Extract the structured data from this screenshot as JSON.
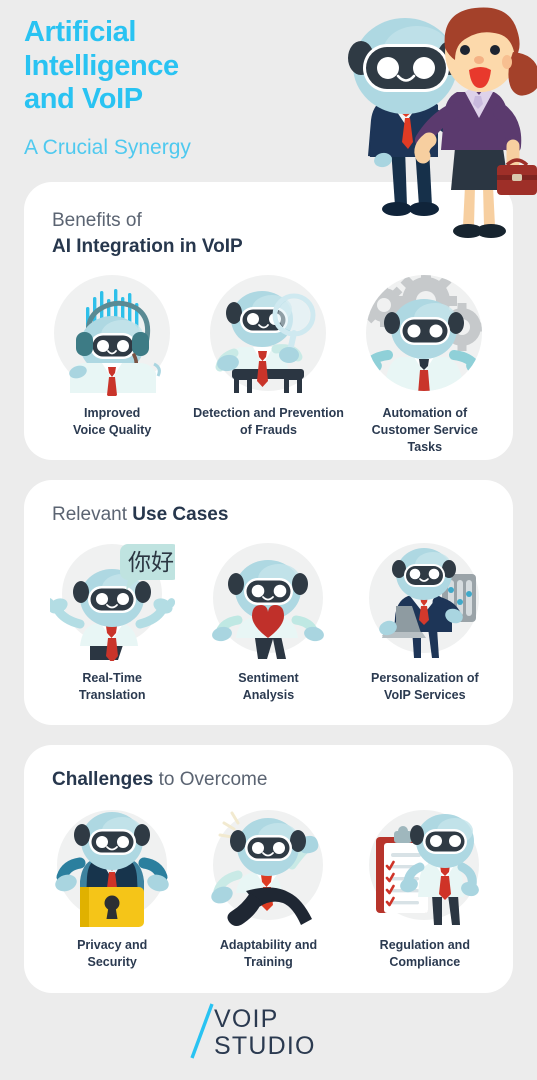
{
  "hero": {
    "title_lines": [
      "Artificial",
      "Intelligence",
      "and VoIP"
    ],
    "subtitle": "A Crucial Synergy",
    "illustration": "robot-handshake-businesswoman-illustration",
    "title_color": "#29c3f2",
    "subtitle_color": "#4fc9ef"
  },
  "theme": {
    "background": "#ececec",
    "card_background": "#ffffff",
    "accent_cyan": "#29c3f2",
    "heading_dark": "#27374d",
    "heading_light": "#5b6472",
    "caption_color": "#2b3a50",
    "robot_body": "#b8dde6",
    "robot_face": "#2f3a44",
    "tie_red": "#d93025",
    "suit_navy": "#1d3557"
  },
  "sections": [
    {
      "id": "benefits",
      "title_light": "Benefits of",
      "title_bold": "AI Integration in VoIP",
      "title_layout": "stacked",
      "items": [
        {
          "icon": "robot-headset-voice-wave-icon",
          "caption_lines": [
            "Improved",
            "Voice Quality"
          ]
        },
        {
          "icon": "robot-magnifying-glass-icon",
          "caption_lines": [
            "Detection and Prevention",
            "of Frauds"
          ]
        },
        {
          "icon": "robot-gears-automation-icon",
          "caption_lines": [
            "Automation of",
            "Customer Service",
            "Tasks"
          ]
        }
      ]
    },
    {
      "id": "use-cases",
      "title_light": "Relevant ",
      "title_bold": "Use Cases",
      "title_layout": "inline",
      "items": [
        {
          "icon": "robot-speech-bubble-chinese-icon",
          "bubble_text": "你好",
          "caption_lines": [
            "Real-Time",
            "Translation"
          ]
        },
        {
          "icon": "robot-heart-sentiment-icon",
          "caption_lines": [
            "Sentiment",
            "Analysis"
          ]
        },
        {
          "icon": "robot-laptop-touchscreen-icon",
          "caption_lines": [
            "Personalization of",
            "VoIP Services"
          ]
        }
      ]
    },
    {
      "id": "challenges",
      "title_bold": "Challenges",
      "title_light": " to Overcome",
      "title_layout": "inline-bold-first",
      "items": [
        {
          "icon": "robot-padlock-security-icon",
          "caption_lines": [
            "Privacy and",
            "Security"
          ]
        },
        {
          "icon": "robot-running-adaptability-icon",
          "caption_lines": [
            "Adaptability and",
            "Training"
          ]
        },
        {
          "icon": "robot-clipboard-checklist-icon",
          "caption_lines": [
            "Regulation and",
            "Compliance"
          ]
        }
      ]
    }
  ],
  "footer": {
    "logo_line1": "VOIP",
    "logo_line2": "STUDIO",
    "logo_slash": "/",
    "logo_text_color": "#2b3a50",
    "logo_slash_color": "#29c3f2"
  }
}
